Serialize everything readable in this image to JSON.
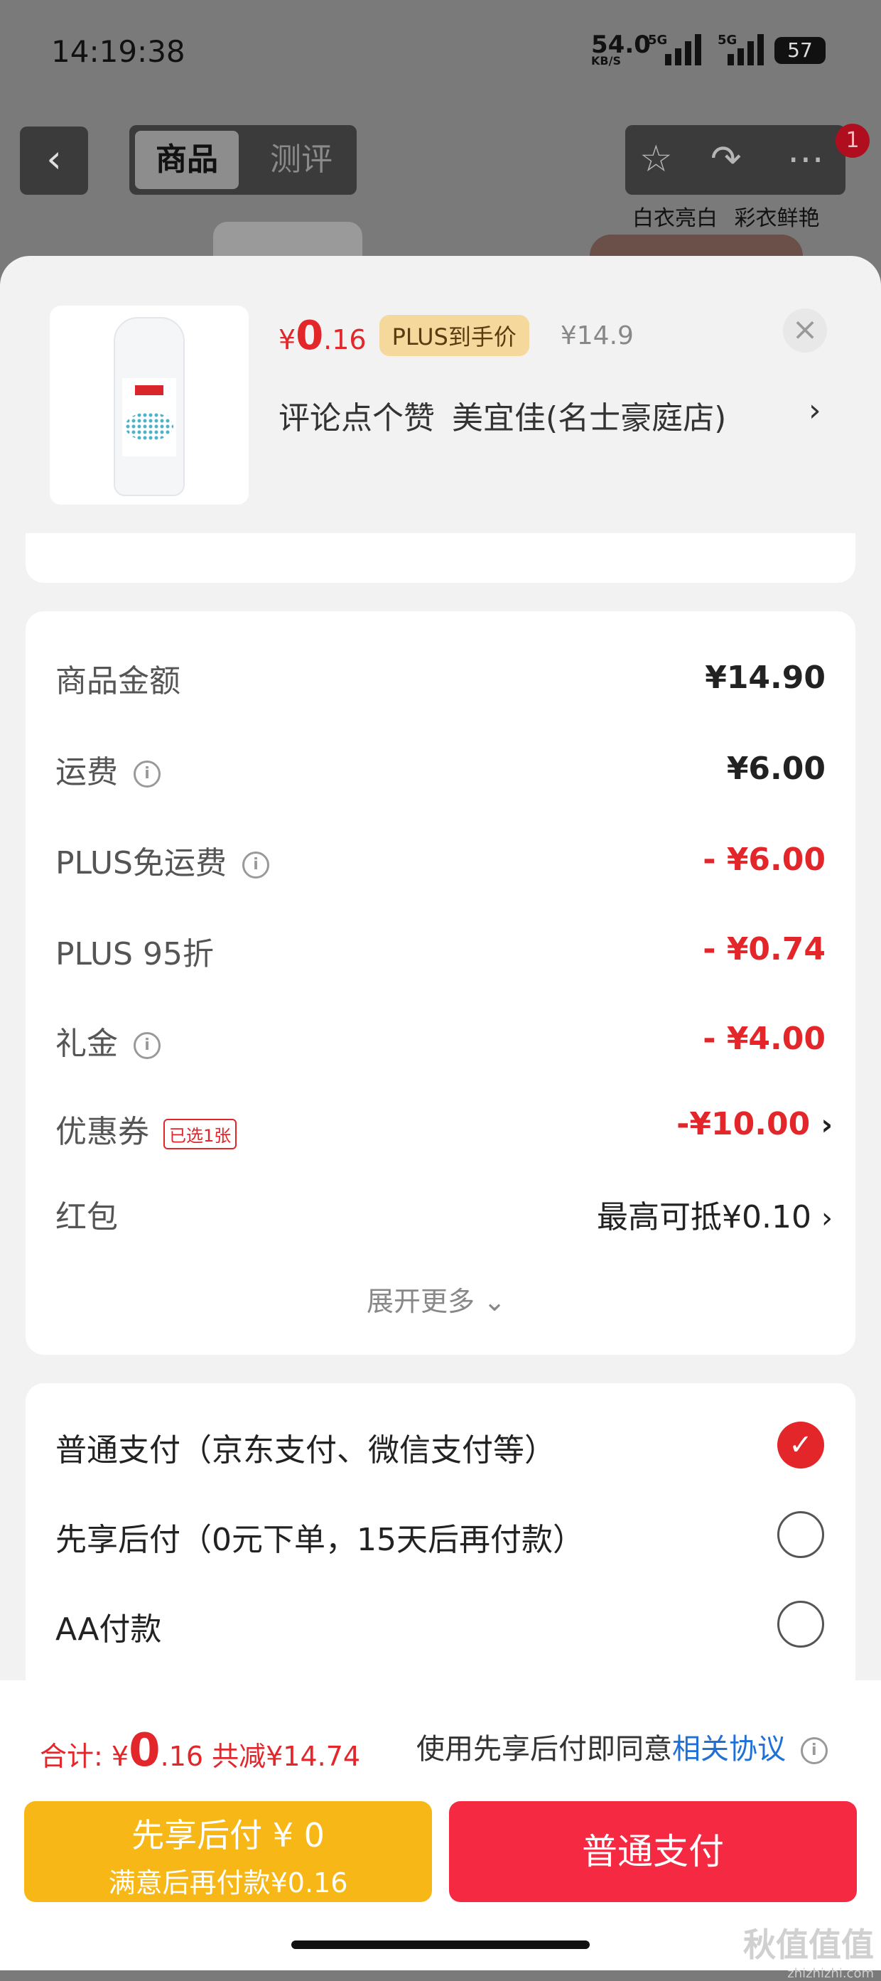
{
  "status_bar": {
    "time": "14:19:38",
    "net_speed": "54.0",
    "net_unit": "KB/S",
    "sig1": "5G",
    "sig2": "5G",
    "battery": "57"
  },
  "header": {
    "back_icon": "chevron-left-icon",
    "tab_goods": "商品",
    "tab_review": "测评",
    "star_icon": "star-icon",
    "share_icon": "share-icon",
    "more_icon": "more-icon",
    "badge": "1",
    "caption": "白衣亮白 彩衣鲜艳"
  },
  "product": {
    "currency": "¥",
    "price_int": "0",
    "price_dec": ".16",
    "plus_tag": "PLUS到手价",
    "original": "¥14.9",
    "store": "评论点个赞 美宜佳(名士豪庭店)",
    "close": "×",
    "chevron": "›"
  },
  "cost": {
    "goods_label": "商品金额",
    "goods_value": "¥14.90",
    "shipping_label": "运费",
    "shipping_value": "¥6.00",
    "plus_ship_label": "PLUS免运费",
    "plus_ship_value": "- ¥6.00",
    "plus95_label": "PLUS 95折",
    "plus95_value": "- ¥0.74",
    "gift_label": "礼金",
    "gift_value": "- ¥4.00",
    "coupon_label": "优惠券",
    "coupon_tag": "已选1张",
    "coupon_value": "-¥10.00",
    "redpack_label": "红包",
    "redpack_value": "最高可抵¥0.10",
    "expand": "展开更多",
    "info": "i",
    "chevron": "›"
  },
  "payment": {
    "normal": "普通支付（京东支付、微信支付等）",
    "later": "先享后付（0元下单，15天后再付款）",
    "aa": "AA付款",
    "check": "✓"
  },
  "footer": {
    "total_label": "合计: ",
    "currency": "¥",
    "total_int": "0",
    "total_dec": ".16",
    "saved": " 共减¥14.74",
    "agree_text": "使用先享后付即同意",
    "agree_link": "相关协议",
    "btn_later_l1": "先享后付 ¥ 0",
    "btn_later_l2": "满意后再付款¥0.16",
    "btn_normal": "普通支付"
  },
  "watermark": {
    "text": "秋值值值",
    "url": "zhizhizhi.com"
  }
}
